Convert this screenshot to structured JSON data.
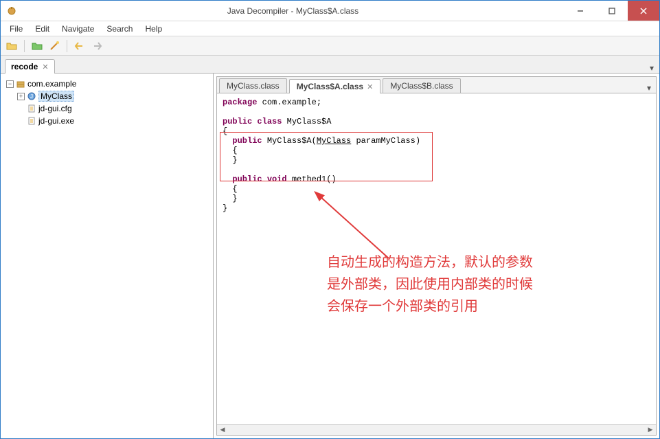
{
  "window": {
    "title": "Java Decompiler - MyClass$A.class"
  },
  "menus": [
    "File",
    "Edit",
    "Navigate",
    "Search",
    "Help"
  ],
  "topTab": {
    "label": "recode"
  },
  "tree": {
    "root": "com.example",
    "classNode": "MyClass",
    "file1": "jd-gui.cfg",
    "file2": "jd-gui.exe"
  },
  "editorTabs": {
    "t1": "MyClass.class",
    "t2": "MyClass$A.class",
    "t3": "MyClass$B.class"
  },
  "code": {
    "kw_package": "package",
    "pkg": " com.example;",
    "kw_public": "public",
    "kw_class": "class",
    "classname": " MyClass$A",
    "lbrace": "{",
    "rbrace": "}",
    "ctor1": "  ",
    "ctor_name": " MyClass$A(",
    "ctor_param_type": "MyCla",
    "ctor_param_type2": "ss",
    "ctor_param_rest": " paramMyClass)",
    "lb2": "  {",
    "rb2": "  }",
    "blank": "",
    "kw_void": "void",
    "methodname": " methed1()"
  },
  "annotation": {
    "line1": "自动生成的构造方法，默认的参数",
    "line2": "是外部类，因此使用内部类的时候",
    "line3": "会保存一个外部类的引用"
  }
}
